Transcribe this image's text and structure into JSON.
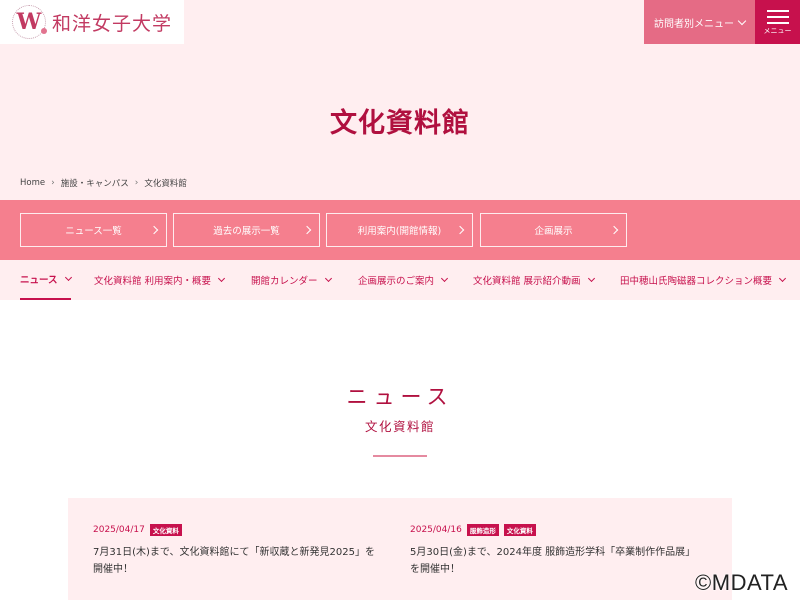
{
  "header": {
    "logo_text": "和洋女子大学",
    "logo_letter": "W",
    "visitor_menu_label": "訪問者別メニュー",
    "menu_label": "メニュー"
  },
  "hero": {
    "title": "文化資料館",
    "breadcrumb": [
      "Home",
      "施設・キャンパス",
      "文化資料館"
    ]
  },
  "quick_buttons": [
    "ニュース一覧",
    "過去の展示一覧",
    "利用案内(開館情報)",
    "企画展示"
  ],
  "tabs": [
    "ニュース",
    "文化資料館 利用案内・概要",
    "開館カレンダー",
    "企画展示のご案内",
    "文化資料館 展示紹介動画",
    "田中穂山氏陶磁器コレクション概要"
  ],
  "news": {
    "heading": "ニュース",
    "subheading": "文化資料館",
    "items": [
      {
        "date": "2025/04/17",
        "tags": [
          "文化資料"
        ],
        "text": "7月31日(木)まで、文化資料館にて「新収蔵と新発見2025」を開催中！"
      },
      {
        "date": "2025/04/16",
        "tags": [
          "服飾造形",
          "文化資料"
        ],
        "text": "5月30日(金)まで、2024年度 服飾造形学科「卒業制作作品展」を開催中！"
      }
    ]
  },
  "watermark": "©MDATA",
  "colors": {
    "brand": "#c7114d",
    "strip": "#f57f8e",
    "background_pink": "#ffeef0"
  }
}
